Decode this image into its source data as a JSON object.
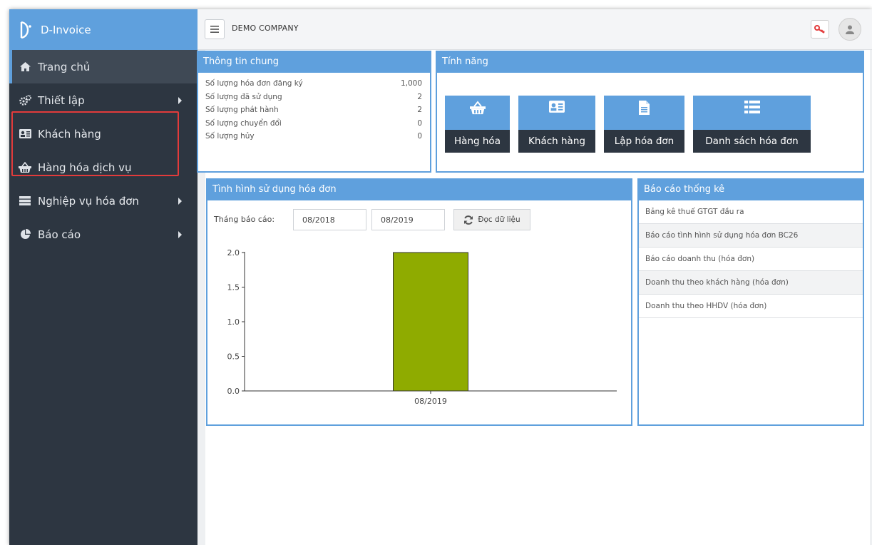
{
  "app": {
    "brand_name": "D-Invoice",
    "company_name": "DEMO COMPANY"
  },
  "sidebar": {
    "items": [
      {
        "label": "Trang chủ",
        "icon": "home-icon"
      },
      {
        "label": "Thiết lập",
        "icon": "cogs-icon"
      },
      {
        "label": "Khách hàng",
        "icon": "id-card-icon"
      },
      {
        "label": "Hàng hóa dịch vụ",
        "icon": "basket-icon"
      },
      {
        "label": "Nghiệp vụ hóa đơn",
        "icon": "server-icon"
      },
      {
        "label": "Báo cáo",
        "icon": "pie-chart-icon"
      }
    ]
  },
  "info_panel": {
    "title": "Thông tin chung",
    "rows": [
      {
        "label": "Số lượng hóa đơn đăng ký",
        "value": "1,000"
      },
      {
        "label": "Số lượng đã sử dụng",
        "value": "2"
      },
      {
        "label": "Số lượng phát hành",
        "value": "2"
      },
      {
        "label": "Số lượng chuyển đổi",
        "value": "0"
      },
      {
        "label": "Số lượng hủy",
        "value": "0"
      }
    ]
  },
  "features_panel": {
    "title": "Tính năng",
    "items": [
      {
        "label": "Hàng hóa",
        "icon": "basket-icon"
      },
      {
        "label": "Khách hàng",
        "icon": "id-card-icon"
      },
      {
        "label": "Lập hóa đơn",
        "icon": "file-icon"
      },
      {
        "label": "Danh sách hóa đơn",
        "icon": "list-icon"
      }
    ]
  },
  "usage_panel": {
    "title": "Tình hình sử dụng hóa đơn",
    "month_label": "Tháng báo cáo:",
    "from_value": "08/2018",
    "to_value": "08/2019",
    "reload_label": "Đọc dữ liệu"
  },
  "report_panel": {
    "title": "Báo cáo thống kê",
    "items": [
      "Bảng kê thuế GTGT đầu ra",
      "Báo cáo tình hình sử dụng hóa đơn BC26",
      "Báo cáo doanh thu (hóa đơn)",
      "Doanh thu theo khách hàng (hóa đơn)",
      "Doanh thu theo HHDV (hóa đơn)"
    ]
  },
  "colors": {
    "accent": "#5fa0dd",
    "sidebar": "#2d3641",
    "bar": "#8fab00",
    "highlight": "#e33b3b"
  },
  "chart_data": {
    "type": "bar",
    "categories": [
      "08/2019"
    ],
    "values": [
      2
    ],
    "ylim": [
      0,
      2
    ],
    "yticks": [
      "0.0",
      "0.5",
      "1.0",
      "1.5",
      "2.0"
    ],
    "grid": false
  }
}
